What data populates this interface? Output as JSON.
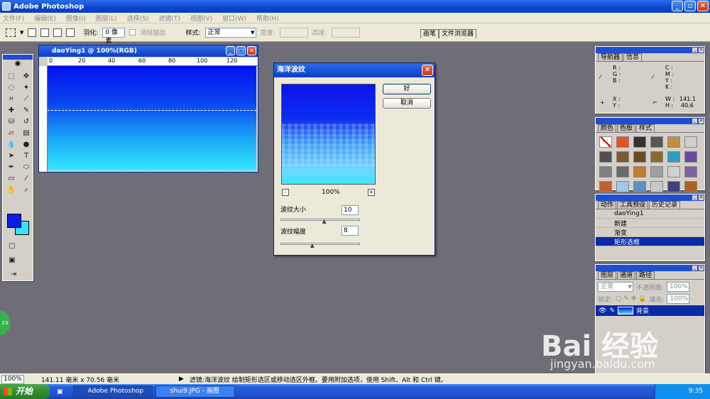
{
  "window": {
    "title": "Adobe Photoshop"
  },
  "menu": [
    "文件(F)",
    "编辑(E)",
    "图像(I)",
    "图层(L)",
    "选择(S)",
    "滤镜(T)",
    "视图(V)",
    "窗口(W)",
    "帮助(H)"
  ],
  "options": {
    "feather_label": "羽化:",
    "feather_value": "0 像素",
    "antialias_label": "消除锯齿",
    "style_label": "样式:",
    "style_value": "正常",
    "width_label": "宽度:",
    "height_label": "高度:",
    "palette_tabs": [
      "画笔",
      "文件浏览器"
    ]
  },
  "document": {
    "title": "daoYing1 @ 100%(RGB)",
    "ruler_ticks": [
      "0",
      "20",
      "40",
      "60",
      "80",
      "100",
      "120"
    ]
  },
  "dialog": {
    "title": "海洋波纹",
    "ok": "好",
    "cancel": "取消",
    "zoom_minus": "-",
    "zoom_plus": "+",
    "zoom_level": "100%",
    "ripple_size_label": "波纹大小",
    "ripple_size_value": "10",
    "ripple_size_fraction": 0.55,
    "ripple_mag_label": "波纹幅度",
    "ripple_mag_value": "8",
    "ripple_mag_fraction": 0.4
  },
  "panels": {
    "navigator_tabs": [
      "导航器",
      "信息"
    ],
    "info": {
      "rgb": "R :\nG :\nB :",
      "cmyk": "C :\nM :\nY :\nK :",
      "xy": "X :\nY :",
      "w_label": "W :",
      "w_value": "141.1",
      "h_label": "H :",
      "h_value": "40.6"
    },
    "color_tabs": [
      "颜色",
      "色板",
      "样式"
    ],
    "style_colors": [
      "#ffffff",
      "#e8502a",
      "#333333",
      "#555555",
      "#c09040",
      "#cfcfcf",
      "#505050",
      "#7b5a2e",
      "#6a4a20",
      "#8a6a30",
      "#2aa0c0",
      "#6a4aa0",
      "#808080",
      "#6a6a6a",
      "#c08030",
      "#a0a0a0",
      "#d0d0d0",
      "#8060a0",
      "#c06030",
      "#a0c8e8",
      "#6090c0",
      "#c8c8c8",
      "#404080",
      "#b06020"
    ],
    "history_tabs": [
      "动作",
      "工具预设",
      "历史记录"
    ],
    "history": {
      "snapshot": "daoYing1",
      "items": [
        "新建",
        "渐变",
        "矩形选框"
      ]
    },
    "layers_tabs": [
      "图层",
      "通道",
      "路径"
    ],
    "layers": {
      "blend_mode": "正常",
      "opacity_label": "不透明度:",
      "opacity_value": "100%",
      "lock_label": "锁定:",
      "fill_label": "填充:",
      "fill_value": "100%",
      "layer_name": "背景"
    }
  },
  "status": {
    "zoom": "100%",
    "doc_size": "141.11 毫米 x 70.56 毫米",
    "hint": "滤镜:海洋波纹  绘制矩形选区或移动选区外框。要用附加选项，使用 Shift、Alt 和 Ctrl 键。"
  },
  "taskbar": {
    "start": "开始",
    "tasks": [
      "Adobe Photoshop",
      "shui9.JPG - 画图"
    ],
    "clock": "9:35"
  },
  "overlay": {
    "badge": "23",
    "watermark": "Bai 经验",
    "watermark_url": "jingyan.baidu.com"
  }
}
